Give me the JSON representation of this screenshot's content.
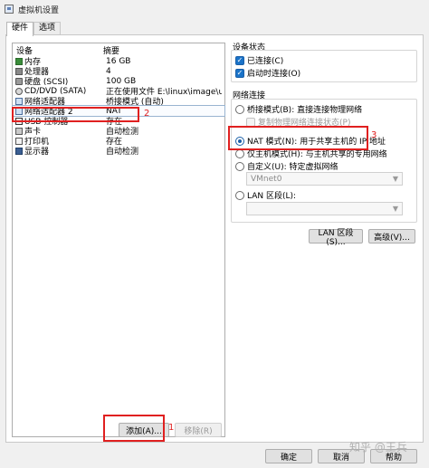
{
  "window": {
    "title": "虚拟机设置"
  },
  "tabs": [
    {
      "label": "硬件",
      "active": true
    },
    {
      "label": "选项",
      "active": false
    }
  ],
  "device_list": {
    "header": {
      "device": "设备",
      "summary": "摘要"
    },
    "rows": [
      {
        "name": "内存",
        "summary": "16 GB",
        "icon": "memory-icon"
      },
      {
        "name": "处理器",
        "summary": "4",
        "icon": "cpu-icon"
      },
      {
        "name": "硬盘 (SCSI)",
        "summary": "100 GB",
        "icon": "hdd-icon"
      },
      {
        "name": "CD/DVD (SATA)",
        "summary": "正在使用文件 E:\\linux\\image\\u...",
        "icon": "cd-icon"
      },
      {
        "name": "网络适配器",
        "summary": "桥接模式 (自动)",
        "icon": "network-icon"
      },
      {
        "name": "网络适配器 2",
        "summary": "NAT",
        "icon": "network-icon"
      },
      {
        "name": "USB 控制器",
        "summary": "存在",
        "icon": "usb-icon"
      },
      {
        "name": "声卡",
        "summary": "自动检测",
        "icon": "sound-icon"
      },
      {
        "name": "打印机",
        "summary": "存在",
        "icon": "printer-icon"
      },
      {
        "name": "显示器",
        "summary": "自动检测",
        "icon": "monitor-icon"
      }
    ],
    "add_button": "添加(A)...",
    "remove_button": "移除(R)"
  },
  "device_status": {
    "title": "设备状态",
    "connected": "已连接(C)",
    "connect_on_power": "启动时连接(O)"
  },
  "network_connection": {
    "title": "网络连接",
    "bridged": "桥接模式(B): 直接连接物理网络",
    "replicate": "复制物理网络连接状态(P)",
    "nat": "NAT 模式(N): 用于共享主机的 IP 地址",
    "host_only": "仅主机模式(H): 与主机共享的专用网络",
    "custom": "自定义(U): 特定虚拟网络",
    "vmnet_value": "VMnet0",
    "lan_segment": "LAN 区段(L):",
    "lan_segment_value": ""
  },
  "buttons": {
    "lan_segments": "LAN 区段(S)...",
    "advanced": "高级(V)...",
    "ok": "确定",
    "cancel": "取消",
    "help": "帮助"
  },
  "annotations": {
    "one": "1",
    "two": "2",
    "three": "3"
  },
  "watermark": "知乎 @王兵",
  "colors": {
    "annotation_red": "#e02020",
    "checkbox_blue": "#1a73c8"
  }
}
